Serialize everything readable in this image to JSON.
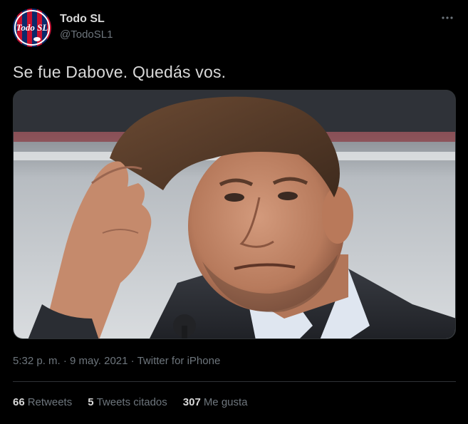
{
  "author": {
    "name": "Todo SL",
    "handle": "@TodoSL1",
    "avatar_text": "Todo SL"
  },
  "tweet": {
    "text": "Se fue Dabove. Quedás vos."
  },
  "meta": {
    "time": "5:32 p. m.",
    "separator1": " · ",
    "date": "9 may. 2021",
    "separator2": " · ",
    "source": "Twitter for iPhone"
  },
  "stats": {
    "retweets_count": "66",
    "retweets_label": "Retweets",
    "quotes_count": "5",
    "quotes_label": "Tweets citados",
    "likes_count": "307",
    "likes_label": "Me gusta"
  },
  "icons": {
    "more": "more-horizontal-icon"
  },
  "colors": {
    "background": "#000000",
    "text_primary": "#d9d9d9",
    "text_secondary": "#6e767d",
    "border": "#2f3336",
    "avatar_blue": "#0b2a6b",
    "avatar_red": "#c8102e"
  }
}
